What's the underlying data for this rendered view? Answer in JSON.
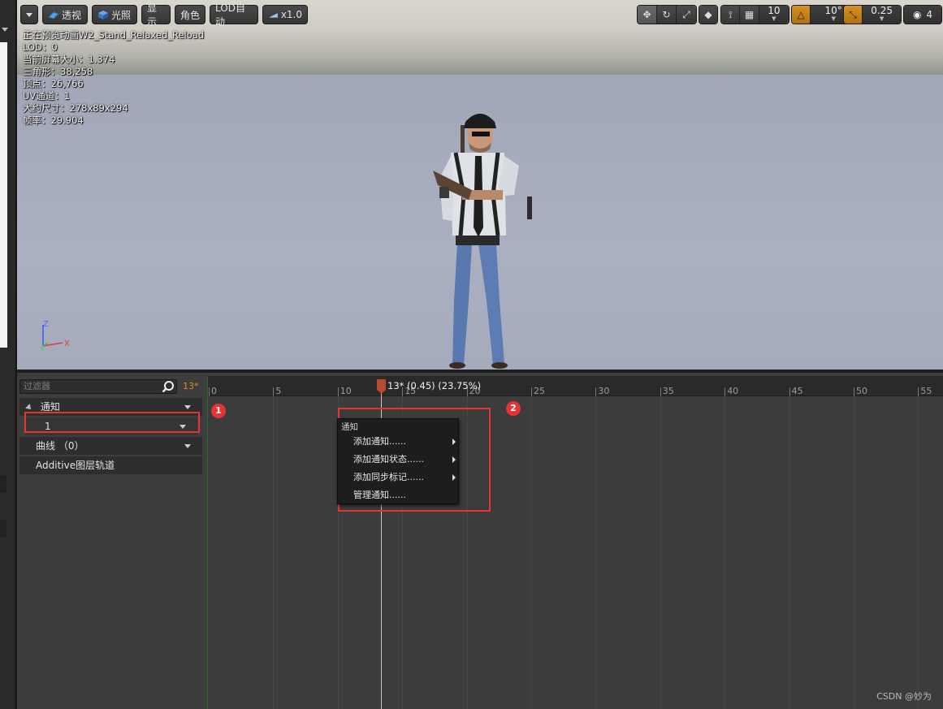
{
  "viewport": {
    "toolbar": {
      "perspective_label": "透视",
      "lighting_label": "光照",
      "show_label": "显示",
      "character_label": "角色",
      "lod_label": "LOD自动",
      "speed_label": "x1.0",
      "grid_snap_value": "10",
      "rotation_snap_value": "10°",
      "scale_snap_value": "0.25",
      "camera_speed_value": "4"
    },
    "stats": {
      "preview_line": "正在预览动画W2_Stand_Relaxed_Reload",
      "lod_line": "LOD：0",
      "screen_size_line": "当前屏幕大小：1.374",
      "triangles_line": "三角形：38,258",
      "vertices_line": "顶点：26,766",
      "uv_line": "UV通道：1",
      "size_line": "大约尺寸：278x89x294",
      "framerate_line": "帧率：29.904"
    },
    "axis": {
      "z": "Z",
      "y": "Y",
      "x": "X"
    }
  },
  "timeline": {
    "filter_placeholder": "过滤器",
    "frame_count": "13*",
    "tracks": {
      "notify_label": "通知",
      "notify_track_value": "1",
      "curves_label": "曲线 （0）",
      "additive_label": "Additive图层轨道"
    },
    "ruler_ticks": [
      "0",
      "5",
      "10",
      "15",
      "20",
      "25",
      "30",
      "35",
      "40",
      "45",
      "50",
      "55"
    ],
    "playhead_label": "13* (0.45) (23.75%)"
  },
  "annotations": {
    "badge1": "1",
    "badge2": "2"
  },
  "context_menu": {
    "title": "通知",
    "items": [
      "添加通知......",
      "添加通知状态......",
      "添加同步标记......",
      "管理通知......"
    ]
  },
  "watermark": "CSDN @妙为"
}
